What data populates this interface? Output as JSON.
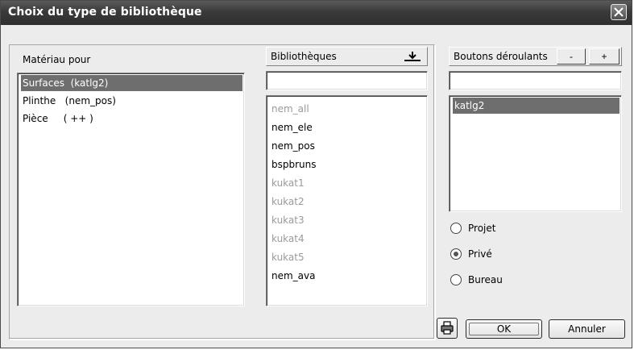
{
  "window": {
    "title": "Choix du type de bibliothèque"
  },
  "materiau": {
    "label": "Matériau pour",
    "items": [
      {
        "text": "Surfaces  (katlg2)",
        "selected": true
      },
      {
        "text": "Plinthe   (nem_pos)",
        "selected": false
      },
      {
        "text": "Pièce     ( ++ )",
        "selected": false
      }
    ]
  },
  "bibliotheques": {
    "label": "Bibliothèques",
    "filter_value": "",
    "items": [
      {
        "text": "nem_all",
        "disabled": true
      },
      {
        "text": "nem_ele",
        "disabled": false
      },
      {
        "text": "nem_pos",
        "disabled": false
      },
      {
        "text": "bspbruns",
        "disabled": false
      },
      {
        "text": "kukat1",
        "disabled": true
      },
      {
        "text": "kukat2",
        "disabled": true
      },
      {
        "text": "kukat3",
        "disabled": true
      },
      {
        "text": "kukat4",
        "disabled": true
      },
      {
        "text": "kukat5",
        "disabled": true
      },
      {
        "text": "nem_ava",
        "disabled": false
      }
    ]
  },
  "boutons": {
    "label": "Boutons déroulants",
    "minus_label": "-",
    "plus_label": "+",
    "filter_value": "",
    "items": [
      {
        "text": "katlg2",
        "selected": true
      }
    ]
  },
  "scope": {
    "options": [
      {
        "label": "Projet",
        "checked": false
      },
      {
        "label": "Privé",
        "checked": true
      },
      {
        "label": "Bureau",
        "checked": false
      }
    ]
  },
  "footer": {
    "ok_label": "OK",
    "cancel_label": "Annuler"
  },
  "icons": {
    "close": "close-icon",
    "download": "download-icon",
    "print": "printer-icon"
  }
}
